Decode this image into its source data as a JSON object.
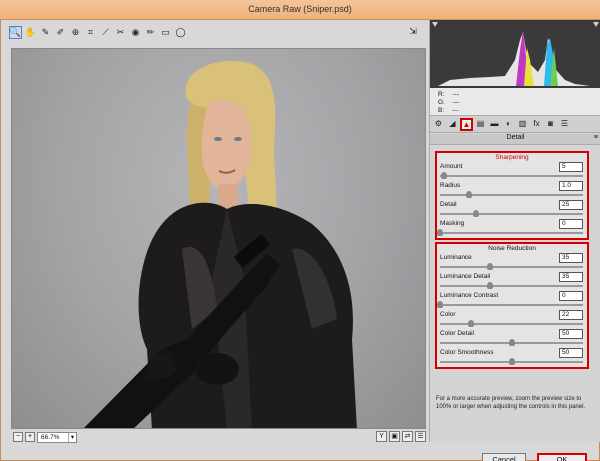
{
  "window": {
    "title": "Camera Raw (Sniper.psd)"
  },
  "toolbar": {
    "tools": [
      {
        "name": "zoom-tool",
        "glyph": "🔍",
        "active": true
      },
      {
        "name": "hand-tool",
        "glyph": "✋",
        "active": false
      },
      {
        "name": "white-balance-tool",
        "glyph": "✎",
        "active": false
      },
      {
        "name": "color-sampler-tool",
        "glyph": "✐",
        "active": false
      },
      {
        "name": "targeted-adjustment-tool",
        "glyph": "⊕",
        "active": false
      },
      {
        "name": "crop-tool",
        "glyph": "⌗",
        "active": false
      },
      {
        "name": "straighten-tool",
        "glyph": "⟋",
        "active": false
      },
      {
        "name": "spot-removal-tool",
        "glyph": "✂",
        "active": false
      },
      {
        "name": "red-eye-tool",
        "glyph": "◉",
        "active": false
      },
      {
        "name": "adjustment-brush-tool",
        "glyph": "✏",
        "active": false
      },
      {
        "name": "graduated-filter-tool",
        "glyph": "▭",
        "active": false
      },
      {
        "name": "radial-filter-tool",
        "glyph": "◯",
        "active": false
      }
    ],
    "fullscreen_icon": "⇲"
  },
  "zoom": {
    "value": "66.7%"
  },
  "readout": {
    "r_label": "R:",
    "r_value": "---",
    "g_label": "G:",
    "g_value": "---",
    "b_label": "B:",
    "b_value": "---"
  },
  "panel_tabs": [
    "⚙",
    "◢",
    "▲",
    "▤",
    "▬",
    "◐",
    "▥",
    "fx",
    "◙",
    "☰"
  ],
  "panel": {
    "section_title": "Detail"
  },
  "sharpening": {
    "title": "Sharpening",
    "controls": [
      {
        "label": "Amount",
        "value": "5",
        "position": 0.03
      },
      {
        "label": "Radius",
        "value": "1.0",
        "position": 0.2
      },
      {
        "label": "Detail",
        "value": "25",
        "position": 0.25
      },
      {
        "label": "Masking",
        "value": "0",
        "position": 0.0
      }
    ]
  },
  "noise_reduction": {
    "title": "Noise Reduction",
    "controls": [
      {
        "label": "Luminance",
        "value": "35",
        "position": 0.35
      },
      {
        "label": "Luminance Detail",
        "value": "35",
        "position": 0.35
      },
      {
        "label": "Luminance Contrast",
        "value": "0",
        "position": 0.0
      },
      {
        "label": "Color",
        "value": "22",
        "position": 0.22
      },
      {
        "label": "Color Detail",
        "value": "50",
        "position": 0.5
      },
      {
        "label": "Color Smoothness",
        "value": "50",
        "position": 0.5
      }
    ]
  },
  "note": "For a more accurate preview, zoom the preview size to 100% or larger when adjusting the controls in this panel.",
  "buttons": {
    "cancel": "Cancel",
    "ok": "OK"
  },
  "colors": {
    "highlight": "#d40000",
    "title_bar": "#f4c59a"
  }
}
